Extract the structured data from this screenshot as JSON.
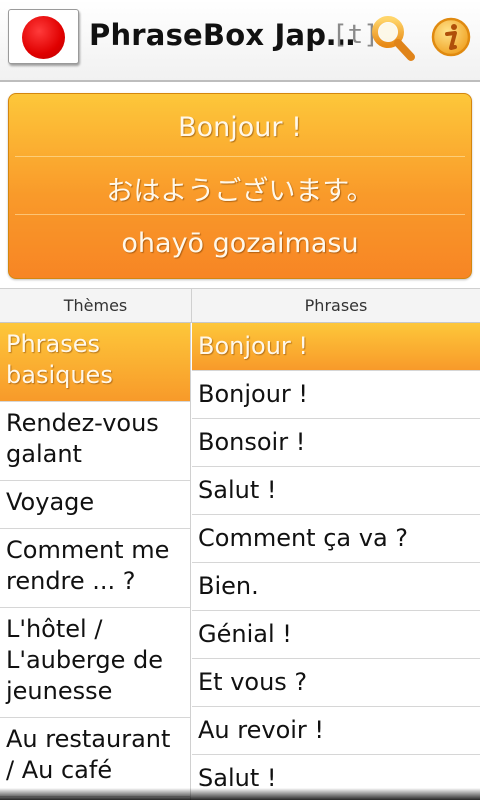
{
  "header": {
    "title": "PhraseBox Jap…",
    "tag_label": "[t]",
    "flag_icon": "japan-flag-icon",
    "search_icon": "search-icon",
    "info_icon": "info-icon"
  },
  "translation": {
    "source": "Bonjour !",
    "target": "おはようございます。",
    "romaji": "ohayō gozaimasu"
  },
  "columns": {
    "themes_header": "Thèmes",
    "phrases_header": "Phrases"
  },
  "themes": [
    "Phrases basiques",
    "Rendez-vous galant",
    "Voyage",
    "Comment me rendre ... ?",
    "L'hôtel / L'auberge de jeunesse",
    "Au restaurant / Au café"
  ],
  "phrases": [
    "Bonjour !",
    "Bonjour !",
    "Bonsoir !",
    "Salut !",
    "Comment ça va ?",
    "Bien.",
    "Génial !",
    "Et vous ?",
    "Au revoir !",
    "Salut !"
  ],
  "colors": {
    "accent_top": "#fdc73a",
    "accent_bottom": "#f78524",
    "flag_red": "#e00000"
  }
}
